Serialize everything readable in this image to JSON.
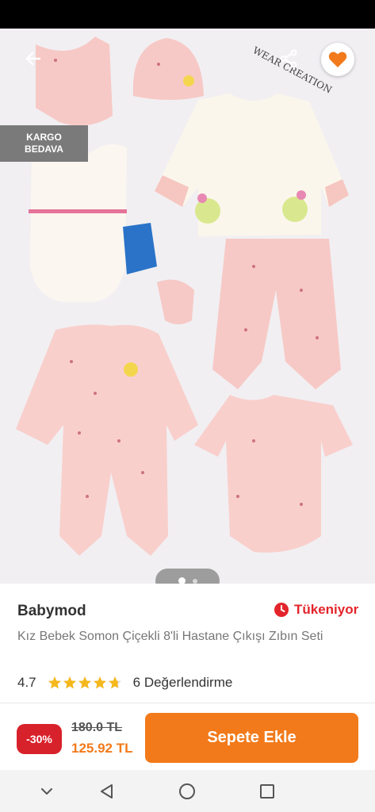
{
  "product_image": {
    "cargo_badge": {
      "line1": "KARGO",
      "line2": "BEDAVA"
    },
    "watermark": "WEAR CREATION",
    "carousel": {
      "current": 1,
      "total": 2
    }
  },
  "product": {
    "brand": "Babymod",
    "stock_status": "Tükeniyor",
    "title": "Kız Bebek Somon Çiçekli 8'li Hastane Çıkışı Zıbın Seti",
    "rating": "4.7",
    "rating_stars": 4.7,
    "review_count_label": "6 Değerlendirme"
  },
  "cart_bar": {
    "discount": "-30%",
    "old_price": "180.0 TL",
    "new_price": "125.92 TL",
    "add_to_cart_label": "Sepete Ekle"
  },
  "icons": {
    "back": "back-arrow-icon",
    "share": "share-icon",
    "favorite": "heart-icon",
    "stock": "clock-icon",
    "nav": [
      "chevron-down-icon",
      "back-triangle-icon",
      "home-circle-icon",
      "recents-square-icon"
    ]
  },
  "colors": {
    "accent": "#f27a1a",
    "discount_red": "#d8222b",
    "stock_red": "#e3242b",
    "star": "#f5b81c"
  }
}
